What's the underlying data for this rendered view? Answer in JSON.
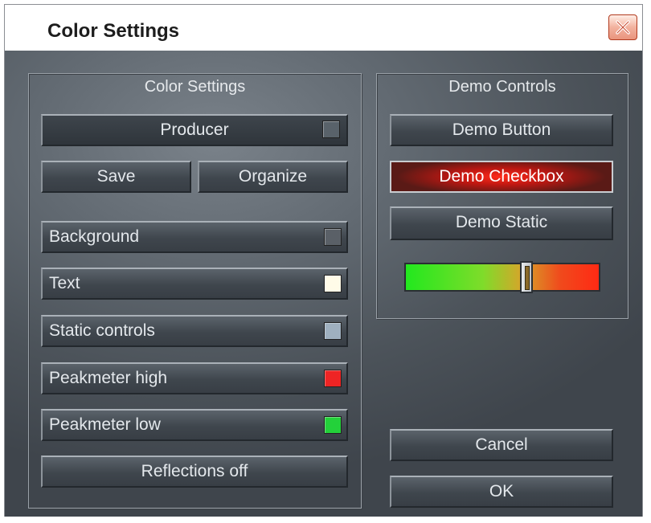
{
  "window": {
    "title": "Color Settings"
  },
  "color_settings": {
    "label": "Color Settings",
    "preset_label": "Producer",
    "save_label": "Save",
    "organize_label": "Organize",
    "items": [
      {
        "label": "Background",
        "color": "#5a6067"
      },
      {
        "label": "Text",
        "color": "#fffbe8"
      },
      {
        "label": "Static controls",
        "color": "#9fb0bf"
      },
      {
        "label": "Peakmeter high",
        "color": "#ee2424"
      },
      {
        "label": "Peakmeter low",
        "color": "#23d13a"
      }
    ],
    "reflections_label": "Reflections off"
  },
  "demo_controls": {
    "label": "Demo Controls",
    "button_label": "Demo Button",
    "checkbox_label": "Demo Checkbox",
    "static_label": "Demo Static",
    "peakmeter_level": 0.59
  },
  "footer": {
    "cancel_label": "Cancel",
    "ok_label": "OK"
  },
  "icons": {
    "close": "close-icon"
  }
}
